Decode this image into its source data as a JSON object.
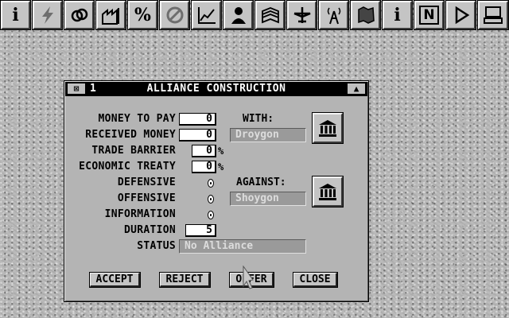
{
  "toolbar": {
    "buttons": [
      {
        "icon": "info-icon",
        "glyph": "i"
      },
      {
        "icon": "lightning-icon",
        "glyph": ""
      },
      {
        "icon": "diplomacy-rings-icon",
        "glyph": ""
      },
      {
        "icon": "factory-icon",
        "glyph": ""
      },
      {
        "icon": "percent-icon",
        "glyph": "%"
      },
      {
        "icon": "no-entry-icon",
        "glyph": ""
      },
      {
        "icon": "graph-icon",
        "glyph": ""
      },
      {
        "icon": "advisor-icon",
        "glyph": ""
      },
      {
        "icon": "book-icon",
        "glyph": ""
      },
      {
        "icon": "plane-icon",
        "glyph": ""
      },
      {
        "icon": "radio-tower-icon",
        "glyph": ""
      },
      {
        "icon": "map-icon",
        "glyph": ""
      },
      {
        "icon": "info-icon",
        "glyph": "i"
      },
      {
        "icon": "news-icon",
        "glyph": "N"
      },
      {
        "icon": "play-icon",
        "glyph": ""
      },
      {
        "icon": "computer-icon",
        "glyph": ""
      }
    ]
  },
  "dialog": {
    "close_glyph": "⊠",
    "window_number": "1",
    "title": "ALLIANCE CONSTRUCTION",
    "resize_glyph": "▲",
    "labels": {
      "money_to_pay": "MONEY TO PAY",
      "received_money": "RECEIVED MONEY",
      "trade_barrier": "TRADE BARRIER",
      "economic_treaty": "ECONOMIC TREATY",
      "defensive": "DEFENSIVE",
      "offensive": "OFFENSIVE",
      "information": "INFORMATION",
      "duration": "DURATION",
      "status": "STATUS",
      "with": "WITH:",
      "against": "AGAINST:",
      "percent": "%"
    },
    "values": {
      "money_to_pay": "0",
      "received_money": "0",
      "trade_barrier": "0",
      "economic_treaty": "0",
      "duration": "5",
      "status": "No Alliance",
      "with_country": "Droygon",
      "against_country": "Shoygon"
    },
    "buttons": {
      "accept": "ACCEPT",
      "reject": "REJECT",
      "offer": "OFFER",
      "close": "CLOSE"
    }
  }
}
